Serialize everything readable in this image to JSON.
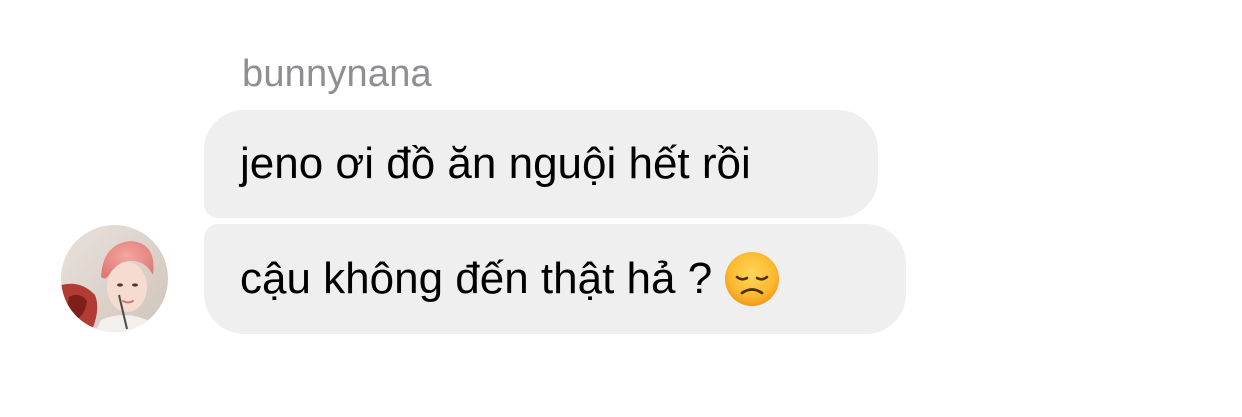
{
  "conversation": {
    "sender_name": "bunnynana",
    "messages": [
      {
        "text": "jeno ơi đồ ăn nguội hết rồi"
      },
      {
        "text": "cậu không đến thật hả ?",
        "emoji": "disappointed-face-emoji"
      }
    ],
    "avatar": "profile-photo-avatar"
  }
}
